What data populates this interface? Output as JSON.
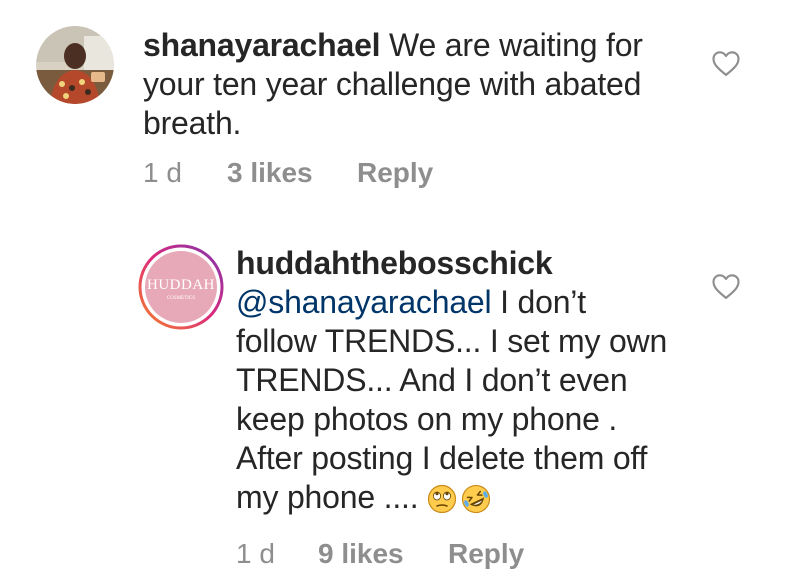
{
  "comments": [
    {
      "username": "shanayarachael",
      "text": "We are waiting for your ten year challenge with abated breath.",
      "lines": [
        " We are waiting for",
        "your ten year challenge with abated",
        "breath."
      ],
      "time": "1 d",
      "likes": "3 likes",
      "reply": "Reply",
      "avatar_icon": "profile-photo-icon",
      "like_icon": "heart-outline-icon"
    },
    {
      "username": "huddahthebosschick",
      "mention": "@shanayarachael",
      "lines": [
        " I don’t",
        "follow TRENDS... I set my own",
        "TRENDS... And I don’t even",
        "keep photos on my phone .",
        "After posting I delete them off",
        "my phone .... "
      ],
      "emojis": [
        "face-with-rolling-eyes-icon",
        "rolling-on-floor-laughing-icon"
      ],
      "avatar_text": "HUDDAH",
      "avatar_subtext": "COSMETICS",
      "time": "1 d",
      "likes": "9 likes",
      "reply": "Reply",
      "like_icon": "heart-outline-icon"
    }
  ],
  "colors": {
    "text": "#262626",
    "meta": "#8e8e8e",
    "mention": "#003569",
    "huddah_pink": "#e7a9b7",
    "ring_gradient": [
      "#f58529",
      "#dd2a7b",
      "#8134af"
    ]
  }
}
